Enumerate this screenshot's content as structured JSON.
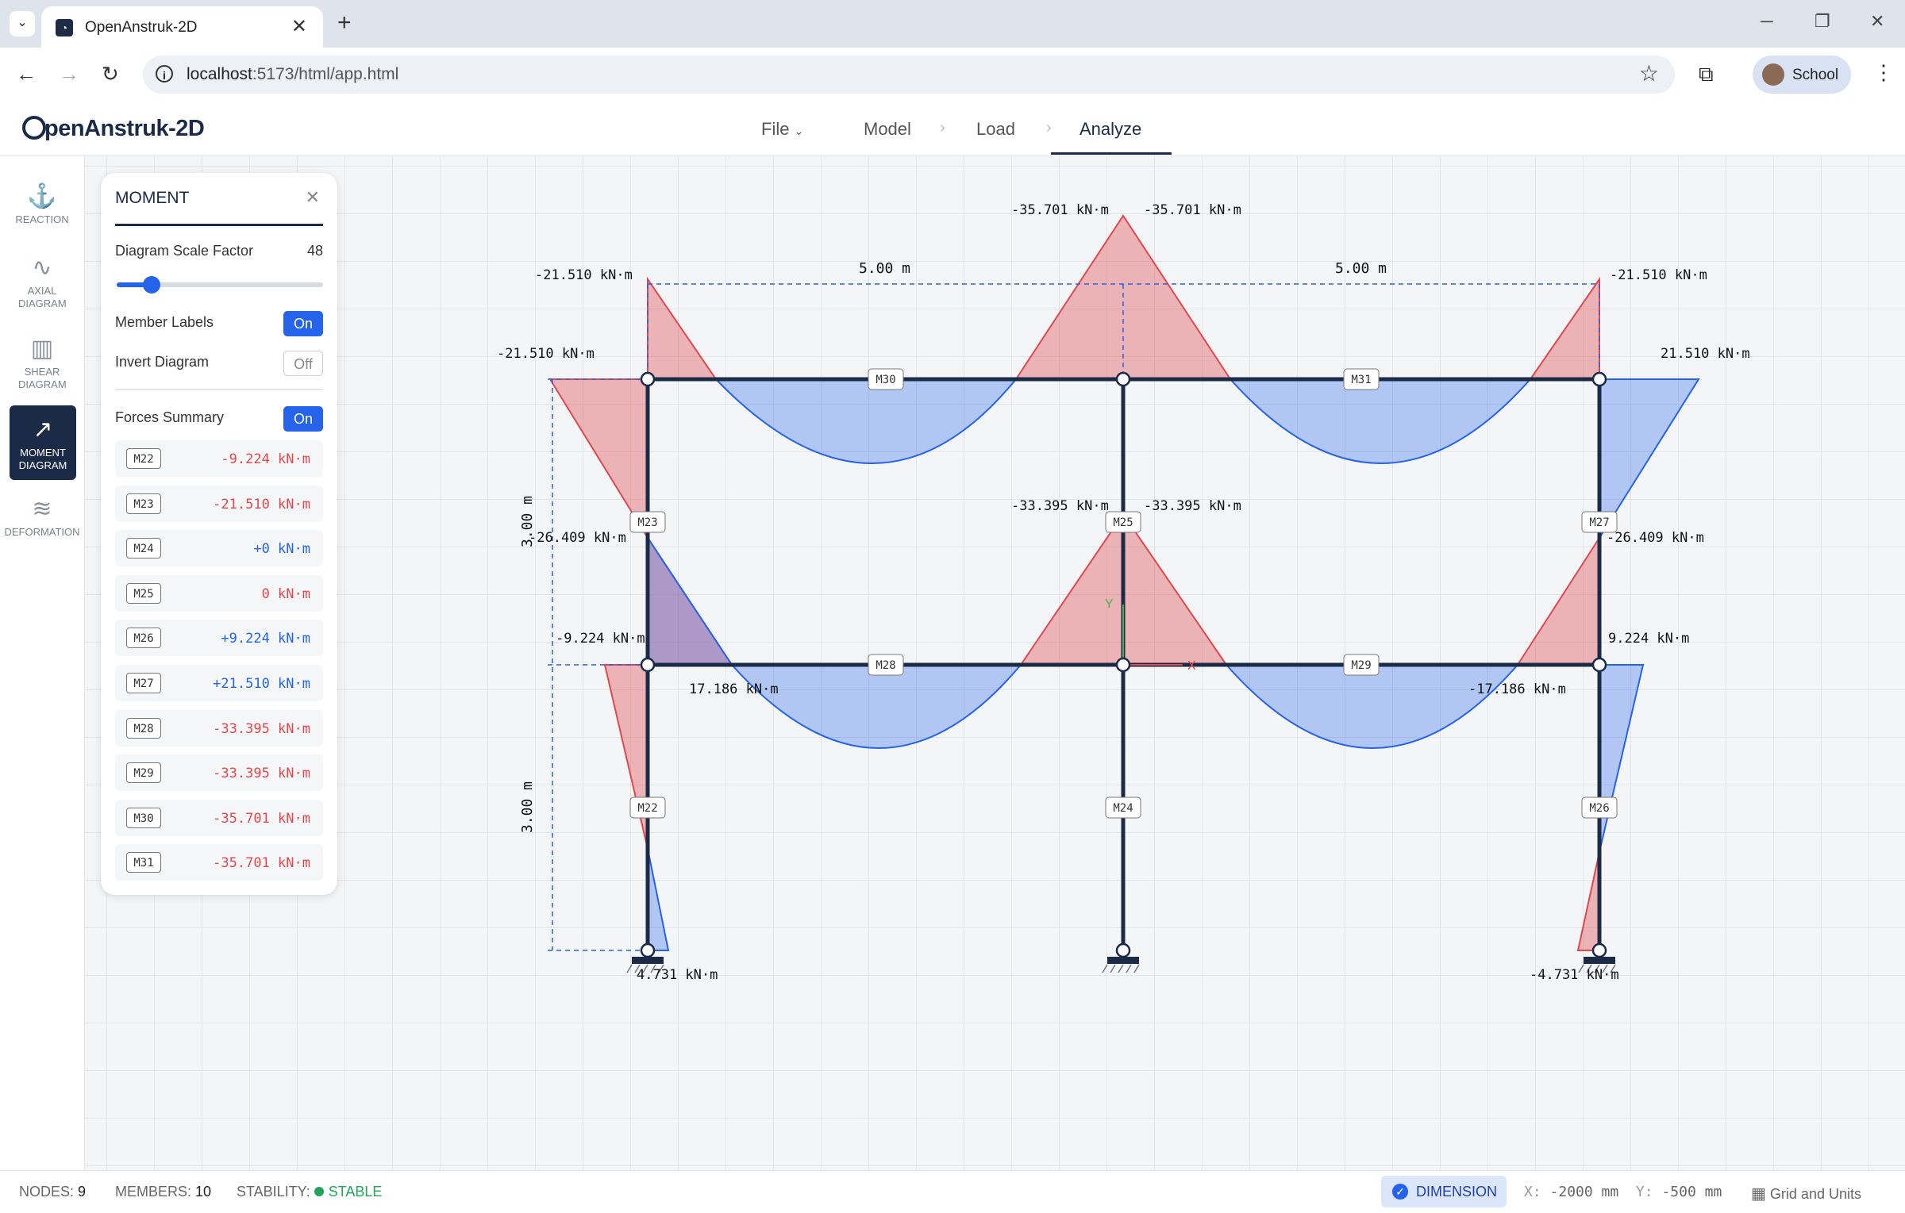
{
  "browser": {
    "tab_title": "OpenAnstruk-2D",
    "url_host": "localhost",
    "url_rest": ":5173/html/app.html",
    "profile_name": "School"
  },
  "app": {
    "logo": "penAnstruk-2D",
    "menu": {
      "file": "File",
      "model": "Model",
      "load": "Load",
      "analyze": "Analyze"
    },
    "rail": [
      {
        "icon": "anchor-icon",
        "label": "REACTION"
      },
      {
        "icon": "axial-wave-icon",
        "label": "AXIAL DIAGRAM"
      },
      {
        "icon": "bar-chart-icon",
        "label": "SHEAR DIAGRAM"
      },
      {
        "icon": "trend-up-icon",
        "label": "MOMENT DIAGRAM"
      },
      {
        "icon": "waves-icon",
        "label": "DEFORMATION"
      }
    ]
  },
  "panel": {
    "title": "MOMENT",
    "scale_label": "Diagram Scale Factor",
    "scale_value": "48",
    "scale_fraction": 0.17,
    "member_labels": {
      "label": "Member Labels",
      "state": "On"
    },
    "invert_diagram": {
      "label": "Invert Diagram",
      "state": "Off"
    },
    "forces_summary": {
      "label": "Forces Summary",
      "state": "On"
    },
    "forces": [
      {
        "member": "M22",
        "value": "-9.224 kN·m",
        "color": "#e0484f"
      },
      {
        "member": "M23",
        "value": "-21.510 kN·m",
        "color": "#e0484f"
      },
      {
        "member": "M24",
        "value": "+0 kN·m",
        "color": "#2563eb"
      },
      {
        "member": "M25",
        "value": "0 kN·m",
        "color": "#e0484f"
      },
      {
        "member": "M26",
        "value": "+9.224 kN·m",
        "color": "#2563eb"
      },
      {
        "member": "M27",
        "value": "+21.510 kN·m",
        "color": "#2563eb"
      },
      {
        "member": "M28",
        "value": "-33.395 kN·m",
        "color": "#e0484f"
      },
      {
        "member": "M29",
        "value": "-33.395 kN·m",
        "color": "#e0484f"
      },
      {
        "member": "M30",
        "value": "-35.701 kN·m",
        "color": "#e0484f"
      },
      {
        "member": "M31",
        "value": "-35.701 kN·m",
        "color": "#e0484f"
      }
    ]
  },
  "canvas": {
    "member_labels": [
      "M30",
      "M31",
      "M23",
      "M25",
      "M27",
      "M28",
      "M29",
      "M22",
      "M24",
      "M26"
    ],
    "moment_labels": [
      "-35.701 kN·m",
      "-35.701 kN·m",
      "-21.510 kN·m",
      "-21.510 kN·m",
      "-21.510 kN·m",
      "21.510 kN·m",
      "-33.395 kN·m",
      "-33.395 kN·m",
      "-26.409 kN·m",
      "-26.409 kN·m",
      "-9.224 kN·m",
      "9.224 kN·m",
      "17.186 kN·m",
      "-17.186 kN·m",
      "4.731 kN·m",
      "-4.731 kN·m"
    ],
    "dimensions": {
      "span_left": "5.00 m",
      "span_right": "5.00 m",
      "story_upper": "3.00 m",
      "story_lower": "3.00 m"
    },
    "axis": {
      "y": "Y",
      "x": "X"
    },
    "colors": {
      "negative": "#e0484f",
      "positive": "#2563eb",
      "frame": "#1b2a46"
    }
  },
  "status": {
    "nodes_label": "NODES:",
    "nodes": "9",
    "members_label": "MEMBERS:",
    "members": "10",
    "stability_label": "STABILITY:",
    "stability": "STABLE",
    "dimension": "DIMENSION",
    "x_label": "X:",
    "x_value": "-2000 mm",
    "y_label": "Y:",
    "y_value": "-500 mm",
    "grid_units": "Grid and Units"
  }
}
